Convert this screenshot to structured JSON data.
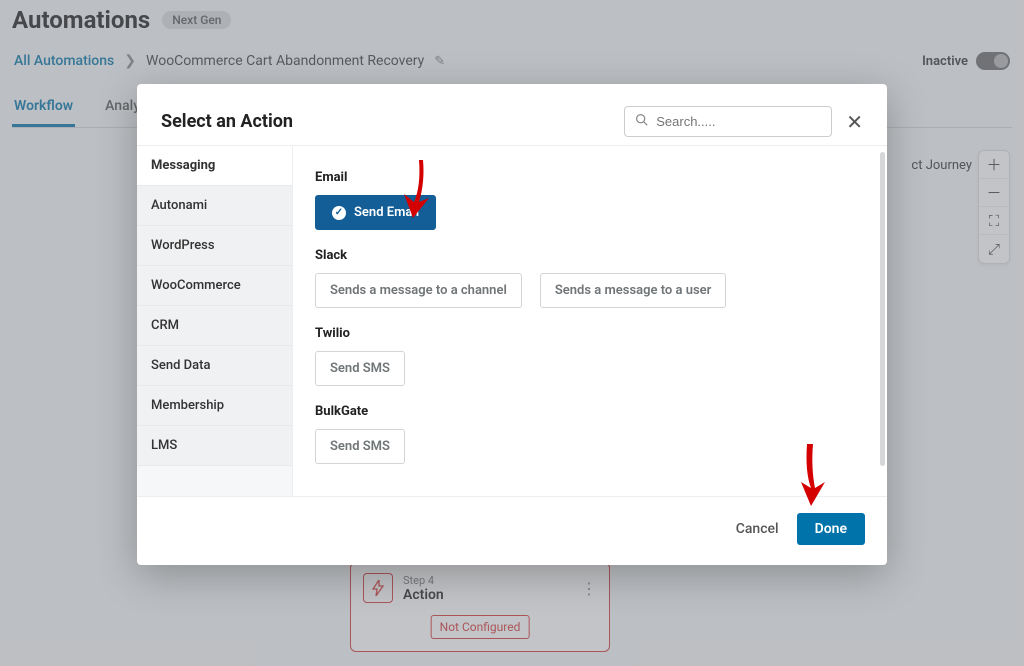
{
  "header": {
    "title": "Automations",
    "badge": "Next Gen"
  },
  "breadcrumb": {
    "root": "All Automations",
    "sep": "❯",
    "current": "WooCommerce Cart Abandonment Recovery"
  },
  "status": {
    "label": "Inactive"
  },
  "tabs": {
    "workflow": "Workflow",
    "analytics": "Analytics"
  },
  "canvas": {
    "journey_partial": "ct Journey",
    "zoom": {
      "in": "＋",
      "out": "－",
      "full": "⛶",
      "fit": "⤢"
    },
    "node": {
      "step": "Step 4",
      "title": "Action",
      "badge": "Not Configured",
      "menu": "⋮"
    }
  },
  "modal": {
    "title": "Select an Action",
    "search_placeholder": "Search.....",
    "close": "✕",
    "categories": [
      "Messaging",
      "Autonami",
      "WordPress",
      "WooCommerce",
      "CRM",
      "Send Data",
      "Membership",
      "LMS"
    ],
    "groups": {
      "email": {
        "label": "Email",
        "actions": {
          "send_email": "Send Email"
        }
      },
      "slack": {
        "label": "Slack",
        "actions": {
          "channel": "Sends a message to a channel",
          "user": "Sends a message to a user"
        }
      },
      "twilio": {
        "label": "Twilio",
        "actions": {
          "sms": "Send SMS"
        }
      },
      "bulkgate": {
        "label": "BulkGate",
        "actions": {
          "sms": "Send SMS"
        }
      }
    },
    "footer": {
      "cancel": "Cancel",
      "done": "Done"
    }
  }
}
